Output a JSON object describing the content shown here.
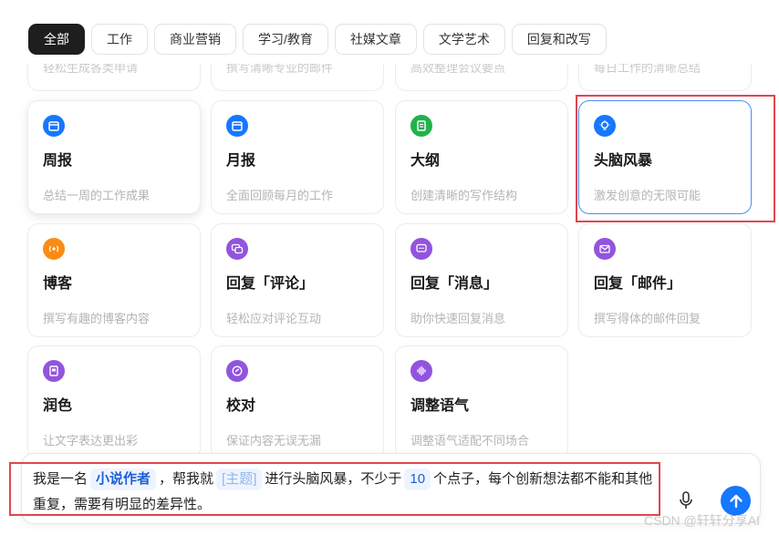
{
  "tabs": [
    {
      "label": "全部",
      "active": true
    },
    {
      "label": "工作"
    },
    {
      "label": "商业营销"
    },
    {
      "label": "学习/教育"
    },
    {
      "label": "社媒文章"
    },
    {
      "label": "文学艺术"
    },
    {
      "label": "回复和改写"
    }
  ],
  "clipped_row": [
    "轻松生成各类申请",
    "撰写清晰专业的邮件",
    "高效整理会议要点",
    "每日工作的清晰总结"
  ],
  "cards": [
    {
      "title": "周报",
      "desc": "总结一周的工作成果",
      "icon": "calendar-icon",
      "color": "#1677ff"
    },
    {
      "title": "月报",
      "desc": "全面回顾每月的工作",
      "icon": "calendar-icon",
      "color": "#1677ff"
    },
    {
      "title": "大纲",
      "desc": "创建清晰的写作结构",
      "icon": "document-icon",
      "color": "#22b24c"
    },
    {
      "title": "头脑风暴",
      "desc": "激发创意的无限可能",
      "icon": "lightbulb-icon",
      "color": "#1677ff"
    },
    {
      "title": "博客",
      "desc": "撰写有趣的博客内容",
      "icon": "broadcast-icon",
      "color": "#fa8c16"
    },
    {
      "title": "回复「评论」",
      "desc": "轻松应对评论互动",
      "icon": "comments-icon",
      "color": "#9254de"
    },
    {
      "title": "回复「消息」",
      "desc": "助你快速回复消息",
      "icon": "chat-icon",
      "color": "#9254de"
    },
    {
      "title": "回复「邮件」",
      "desc": "撰写得体的邮件回复",
      "icon": "mail-icon",
      "color": "#9254de"
    },
    {
      "title": "润色",
      "desc": "让文字表达更出彩",
      "icon": "edit-doc-icon",
      "color": "#9254de"
    },
    {
      "title": "校对",
      "desc": "保证内容无误无漏",
      "icon": "check-circle-icon",
      "color": "#9254de"
    },
    {
      "title": "调整语气",
      "desc": "调整语气适配不同场合",
      "icon": "soundwave-icon",
      "color": "#9254de"
    }
  ],
  "prompt": {
    "t1": "我是一名",
    "role": "小说作者",
    "t2": "，帮我就",
    "topic_placeholder": "[主题]",
    "t3": "进行头脑风暴，不少于",
    "count": "10",
    "t4": "个点子，每个创新想法都不能和其他重复，需要有明显的差异性。"
  },
  "composer": {
    "mic_icon": "microphone-icon",
    "send_icon": "arrow-up-icon"
  },
  "watermark": "CSDN @轩轩分享AI",
  "colors": {
    "accent": "#1677ff",
    "highlight": "#e0464f"
  }
}
